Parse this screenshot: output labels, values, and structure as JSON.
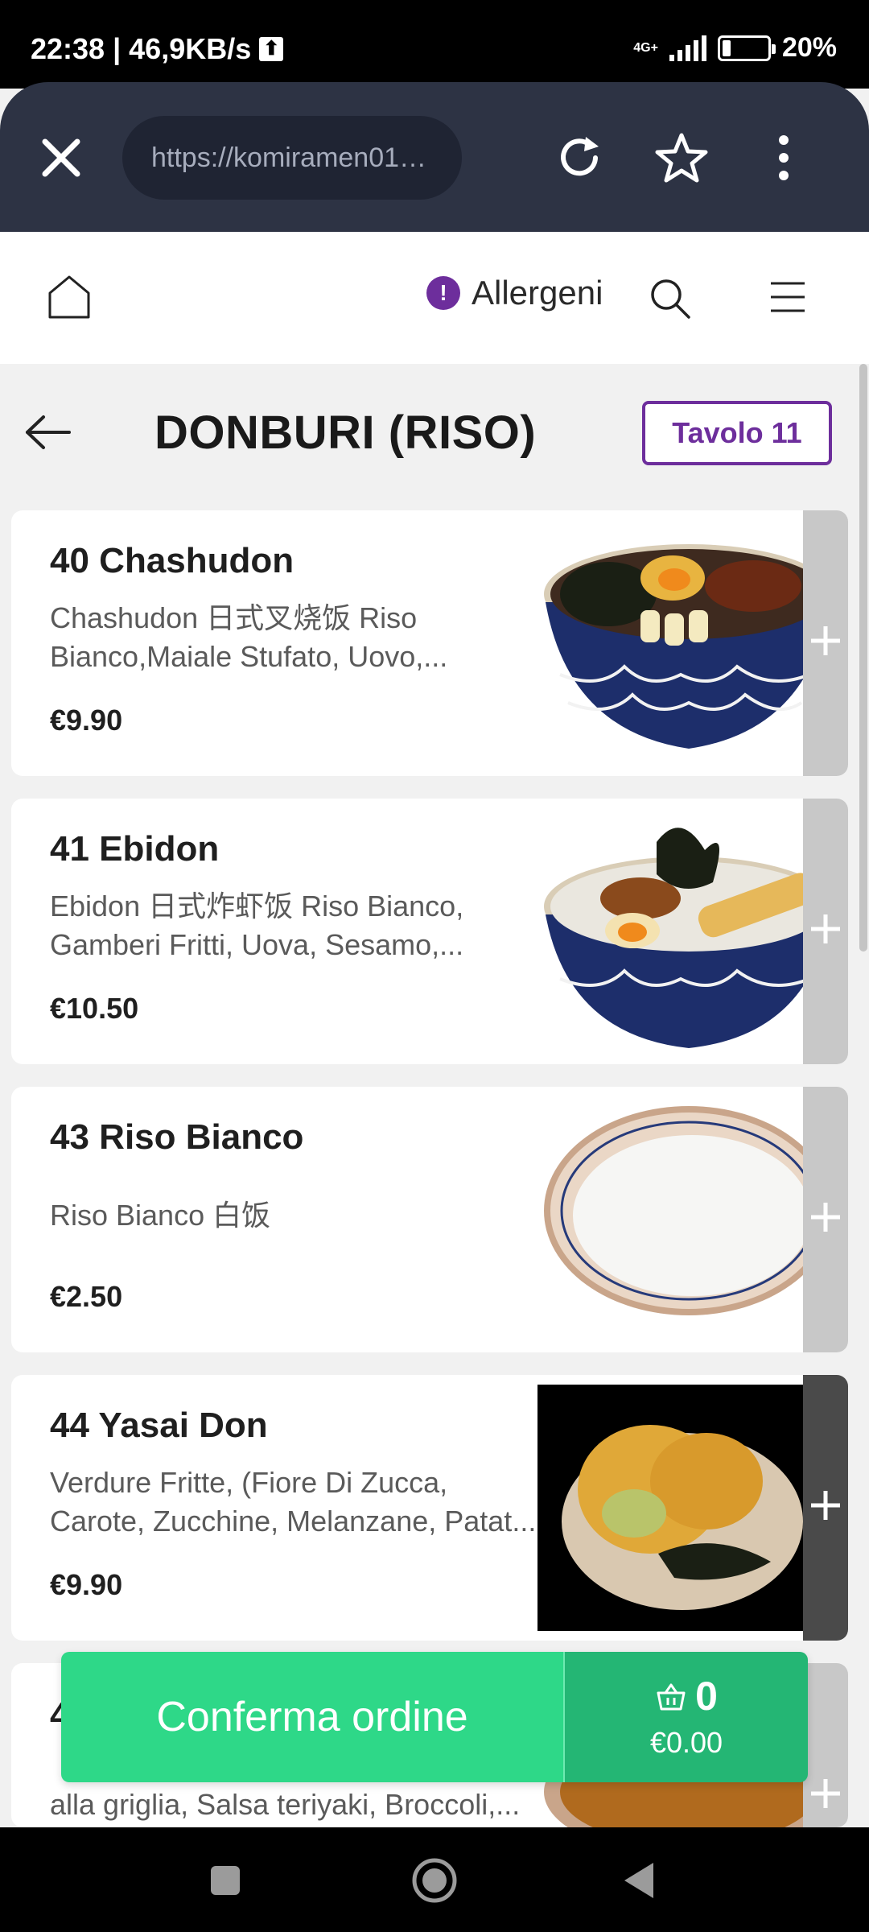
{
  "status_bar": {
    "time": "22:38 | 46,9KB/s",
    "upload_glyph": "⬆",
    "network": "4G+",
    "battery": "20%"
  },
  "browser": {
    "url": "https://komiramen01…",
    "icons": [
      "close-icon",
      "reload-icon",
      "star-icon",
      "more-vertical-icon"
    ]
  },
  "header": {
    "allergen_label": "Allergeni",
    "allergen_badge": "!"
  },
  "category": {
    "title": "DONBURI (RISO)",
    "table": "Tavolo 11"
  },
  "items": [
    {
      "name": "40 Chashudon",
      "desc": "Chashudon 日式叉烧饭 Riso Bianco,Maiale Stufato, Uovo,...",
      "price": "€9.90"
    },
    {
      "name": "41 Ebidon",
      "desc": "Ebidon 日式炸虾饭 Riso Bianco, Gamberi Fritti, Uova, Sesamo,...",
      "price": "€10.50"
    },
    {
      "name": "43 Riso Bianco",
      "desc": "Riso Bianco 白饭",
      "price": "€2.50"
    },
    {
      "name": "44 Yasai Don",
      "desc": "Verdure Fritte, (Fiore Di Zucca, Carote, Zucchine, Melanzane, Patat...",
      "price": "€9.90"
    },
    {
      "name": "4",
      "desc": "alla griglia, Salsa teriyaki, Broccoli,...",
      "price": ""
    }
  ],
  "order": {
    "confirm_label": "Conferma ordine",
    "cart_count": "0",
    "cart_total": "€0.00"
  },
  "colors": {
    "accent": "#6d2e9c",
    "confirm": "#2ed888",
    "cart": "#24b674",
    "browser": "#2d3344"
  }
}
